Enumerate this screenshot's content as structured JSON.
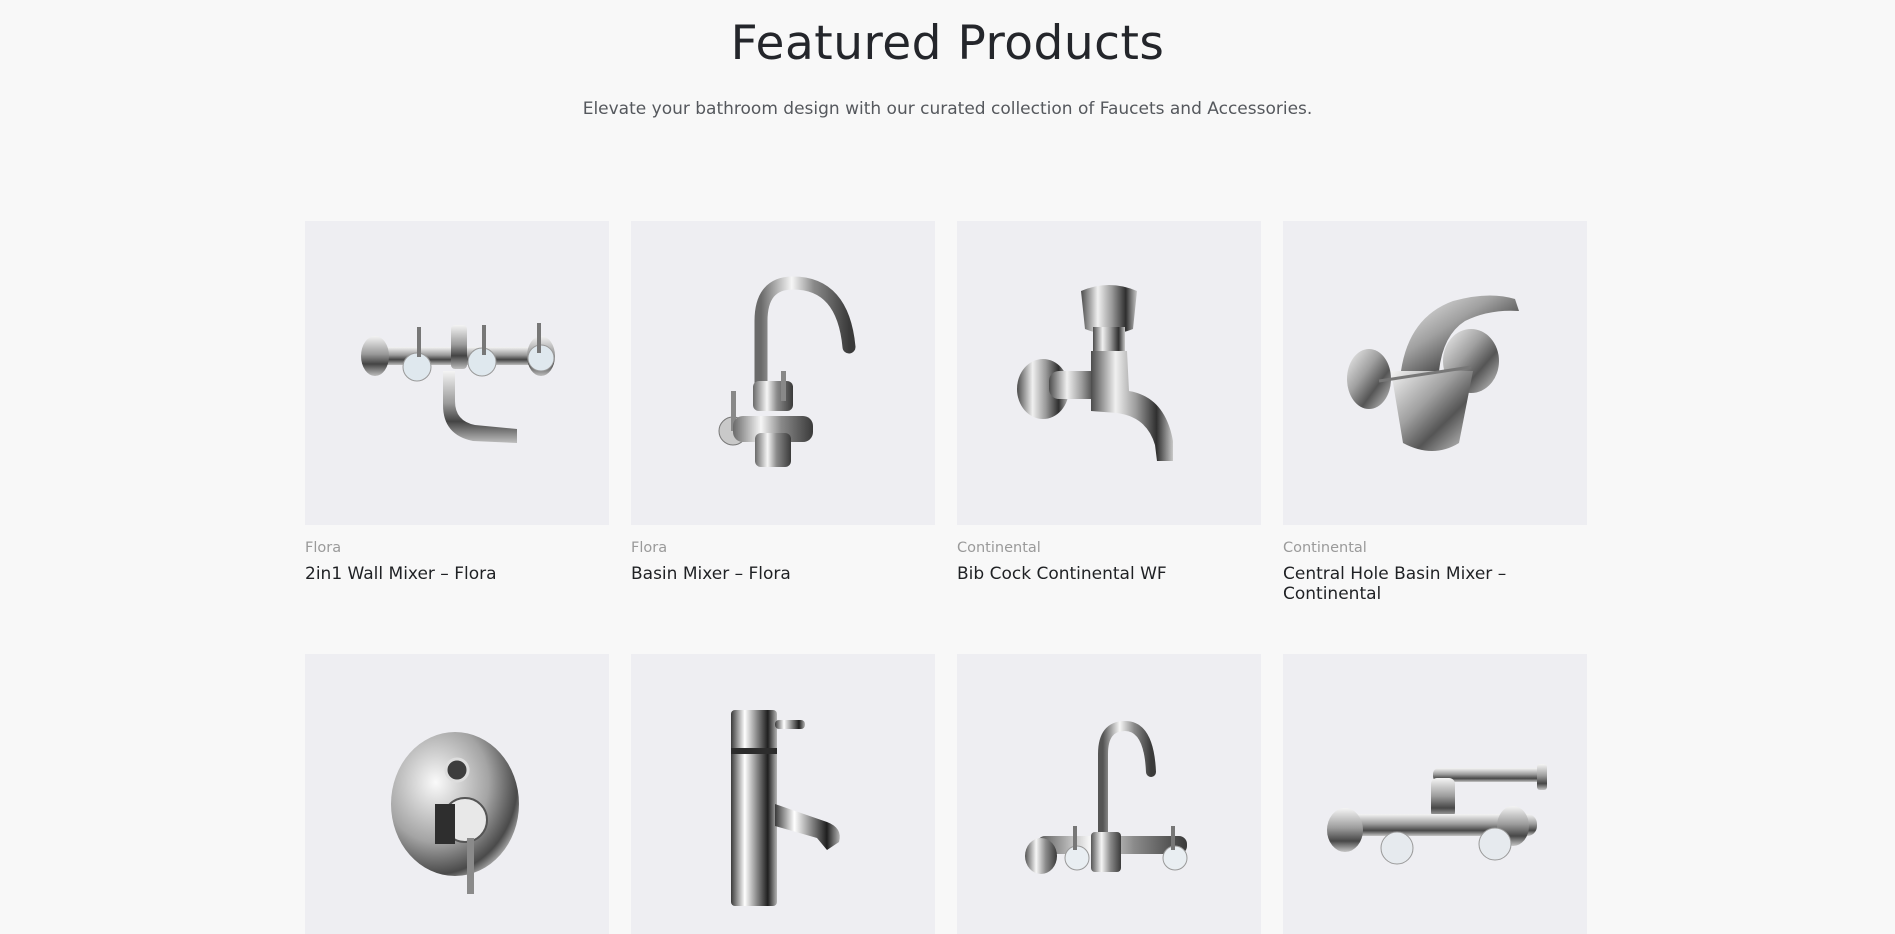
{
  "header": {
    "title": "Featured Products",
    "subtitle": "Elevate your bathroom design with our curated collection of Faucets and Accessories."
  },
  "products": [
    {
      "category": "Flora",
      "name": "2in1 Wall Mixer – Flora",
      "icon": "wall-mixer-icon"
    },
    {
      "category": "Flora",
      "name": "Basin Mixer – Flora",
      "icon": "basin-mixer-icon"
    },
    {
      "category": "Continental",
      "name": "Bib Cock Continental WF",
      "icon": "bib-cock-icon"
    },
    {
      "category": "Continental",
      "name": "Central Hole Basin Mixer – Continental",
      "icon": "central-hole-basin-mixer-icon"
    },
    {
      "icon": "concealed-diverter-icon"
    },
    {
      "icon": "pillar-tap-icon"
    },
    {
      "icon": "sink-mixer-wall-icon"
    },
    {
      "icon": "wall-sink-mixer-swivel-icon"
    }
  ],
  "colors": {
    "background": "#f8f8f8",
    "card_background": "#eeeef2",
    "title": "#24262b",
    "category": "#9a9a9a"
  }
}
